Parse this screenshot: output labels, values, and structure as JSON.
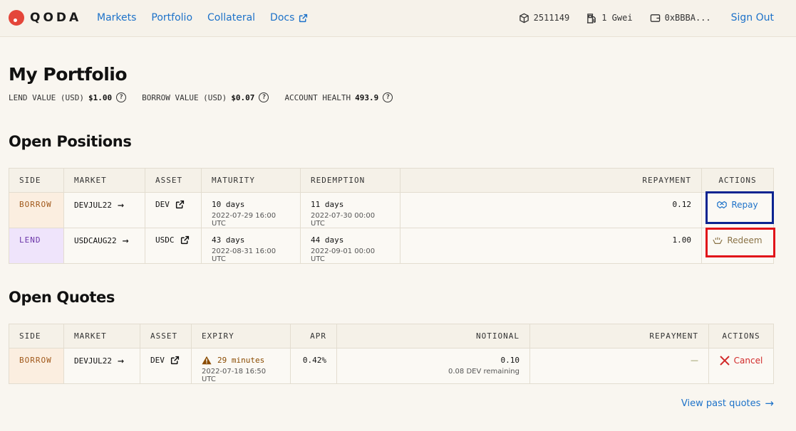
{
  "header": {
    "logo_text": "QODA",
    "nav": [
      {
        "label": "Markets"
      },
      {
        "label": "Portfolio"
      },
      {
        "label": "Collateral"
      },
      {
        "label": "Docs"
      }
    ],
    "block": "2511149",
    "gas": "1 Gwei",
    "wallet": "0xBBBA...",
    "signout": "Sign Out"
  },
  "page_title": "My Portfolio",
  "stats": {
    "lend_label": "LEND VALUE (USD)",
    "lend_value": "$1.00",
    "borrow_label": "BORROW VALUE (USD)",
    "borrow_value": "$0.07",
    "health_label": "ACCOUNT HEALTH",
    "health_value": "493.9"
  },
  "positions": {
    "title": "Open Positions",
    "headers": [
      "SIDE",
      "MARKET",
      "ASSET",
      "MATURITY",
      "REDEMPTION",
      "REPAYMENT",
      "ACTIONS"
    ],
    "rows": [
      {
        "side": "BORROW",
        "market": "DEVJUL22",
        "asset": "DEV",
        "maturity": "10 days",
        "maturity_date": "2022-07-29 16:00 UTC",
        "redemption": "11 days",
        "redemption_date": "2022-07-30 00:00 UTC",
        "repayment": "0.12",
        "action": "Repay"
      },
      {
        "side": "LEND",
        "market": "USDCAUG22",
        "asset": "USDC",
        "maturity": "43 days",
        "maturity_date": "2022-08-31 16:00 UTC",
        "redemption": "44 days",
        "redemption_date": "2022-09-01 00:00 UTC",
        "repayment": "1.00",
        "action": "Redeem"
      }
    ]
  },
  "quotes": {
    "title": "Open Quotes",
    "headers": [
      "SIDE",
      "MARKET",
      "ASSET",
      "EXPIRY",
      "APR",
      "NOTIONAL",
      "REPAYMENT",
      "ACTIONS"
    ],
    "rows": [
      {
        "side": "BORROW",
        "market": "DEVJUL22",
        "asset": "DEV",
        "expiry": "29 minutes",
        "expiry_date": "2022-07-18 16:50 UTC",
        "apr": "0.42%",
        "notional": "0.10",
        "notional_sub": "0.08 DEV remaining",
        "repayment": "—",
        "action": "Cancel"
      }
    ]
  },
  "view_past": "View past quotes"
}
